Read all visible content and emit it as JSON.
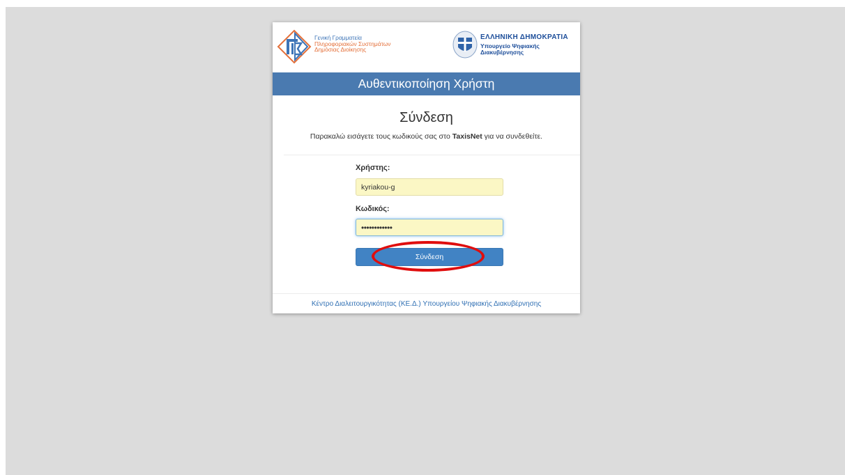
{
  "brand": {
    "gsis_lines": [
      "Γενική Γραμματεία",
      "Πληροφοριακών Συστημάτων",
      "Δημόσιας Διοίκησης"
    ],
    "republic_title": "ΕΛΛΗΝΙΚΗ ΔΗΜΟΚΡΑΤΙΑ",
    "ministry_lines": [
      "Υπουργείο Ψηφιακής",
      "Διακυβέρνησης"
    ]
  },
  "header": {
    "title": "Αυθεντικοποίηση Χρήστη"
  },
  "login": {
    "heading": "Σύνδεση",
    "subtitle_before": "Παρακαλώ εισάγετε τους κωδικούς σας στο ",
    "subtitle_bold": "TaxisNet",
    "subtitle_after": " για να συνδεθείτε.",
    "username_label": "Χρήστης:",
    "username_value": "kyriakou-g",
    "password_label": "Κωδικός:",
    "password_value": "••••••••••••",
    "submit_label": "Σύνδεση"
  },
  "footer": {
    "link_text": "Κέντρο Διαλειτουργικότητας (ΚΕ.Δ.) Υπουργείου Ψηφιακής Διακυβέρνησης"
  },
  "colors": {
    "header_bar": "#4a7ab0",
    "button": "#4183c4",
    "field_autofill": "#fbf7c5",
    "highlight_annotation": "#e00d0d",
    "link": "#2f6fb3"
  }
}
